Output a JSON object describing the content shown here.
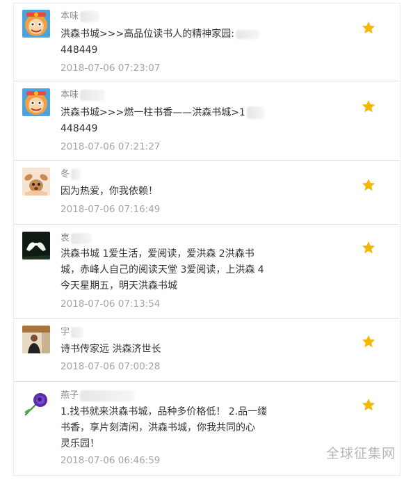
{
  "comments": [
    {
      "name": "本味",
      "lines": [
        "洪森书城>>>高品位读书人的精神家园:",
        "448449"
      ],
      "time": "2018-07-06 07:23:07"
    },
    {
      "name": "本味",
      "lines": [
        "洪森书城>>>燃一柱书香——洪森书城>1",
        "448449"
      ],
      "time": "2018-07-06 07:21:27"
    },
    {
      "name": "冬",
      "lines": [
        "因为热爱，你我依赖！"
      ],
      "time": "2018-07-06 07:16:49"
    },
    {
      "name": "衷",
      "lines": [
        "洪森书城 1爱生活，爱阅读，爱洪森 2洪森书",
        "城，赤峰人自己的阅读天堂 3爱阅读，上洪森 4",
        "今天星期五，明天洪森书城"
      ],
      "time": "2018-07-06 07:13:54"
    },
    {
      "name": "宇",
      "lines": [
        "诗书传家远 洪森济世长"
      ],
      "time": "2018-07-06 07:00:28"
    },
    {
      "name": "燕子",
      "lines": [
        "1.找书就来洪森书城，品种多价格低！ 2.品一缕",
        "书香，享片刻清闲，洪森书城，你我共同的心",
        "灵乐园！"
      ],
      "time": "2018-07-06 06:46:59"
    }
  ],
  "star_color": "#f5b800",
  "icons": {
    "favorite": "star-icon"
  },
  "watermark": "全球征集网"
}
